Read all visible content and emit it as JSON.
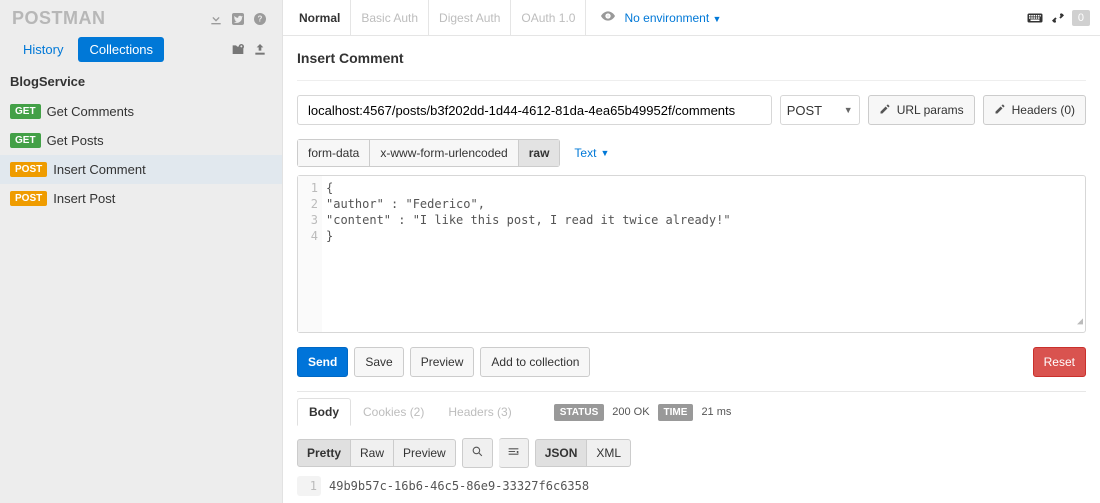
{
  "logo": "POSTMAN",
  "sidebar": {
    "tabs": {
      "history": "History",
      "collections": "Collections"
    },
    "collection_title": "BlogService",
    "items": [
      {
        "method": "GET",
        "label": "Get Comments"
      },
      {
        "method": "GET",
        "label": "Get Posts"
      },
      {
        "method": "POST",
        "label": "Insert Comment"
      },
      {
        "method": "POST",
        "label": "Insert Post"
      }
    ]
  },
  "auth_tabs": [
    "Normal",
    "Basic Auth",
    "Digest Auth",
    "OAuth 1.0"
  ],
  "environment_label": "No environment",
  "top_right_badge": "0",
  "request": {
    "title": "Insert Comment",
    "url": "localhost:4567/posts/b3f202dd-1d44-4612-81da-4ea65b49952f/comments",
    "method": "POST",
    "url_params_btn": "URL params",
    "headers_btn": "Headers (0)",
    "body_types": [
      "form-data",
      "x-www-form-urlencoded",
      "raw"
    ],
    "body_types_selected": "raw",
    "text_dropdown": "Text",
    "body_lines": [
      "1",
      "2",
      "3",
      "4"
    ],
    "body_text": "{\n\"author\" : \"Federico\",\n\"content\" : \"I like this post, I read it twice already!\"\n}"
  },
  "actions": {
    "send": "Send",
    "save": "Save",
    "preview": "Preview",
    "add": "Add to collection",
    "reset": "Reset"
  },
  "response": {
    "tabs": {
      "body": "Body",
      "cookies": "Cookies (2)",
      "headers": "Headers (3)"
    },
    "status_label": "STATUS",
    "status_value": "200 OK",
    "time_label": "TIME",
    "time_value": "21 ms",
    "view": {
      "pretty": "Pretty",
      "raw": "Raw",
      "preview": "Preview",
      "json": "JSON",
      "xml": "XML"
    },
    "body_line_no": "1",
    "body": "49b9b57c-16b6-46c5-86e9-33327f6c6358"
  }
}
